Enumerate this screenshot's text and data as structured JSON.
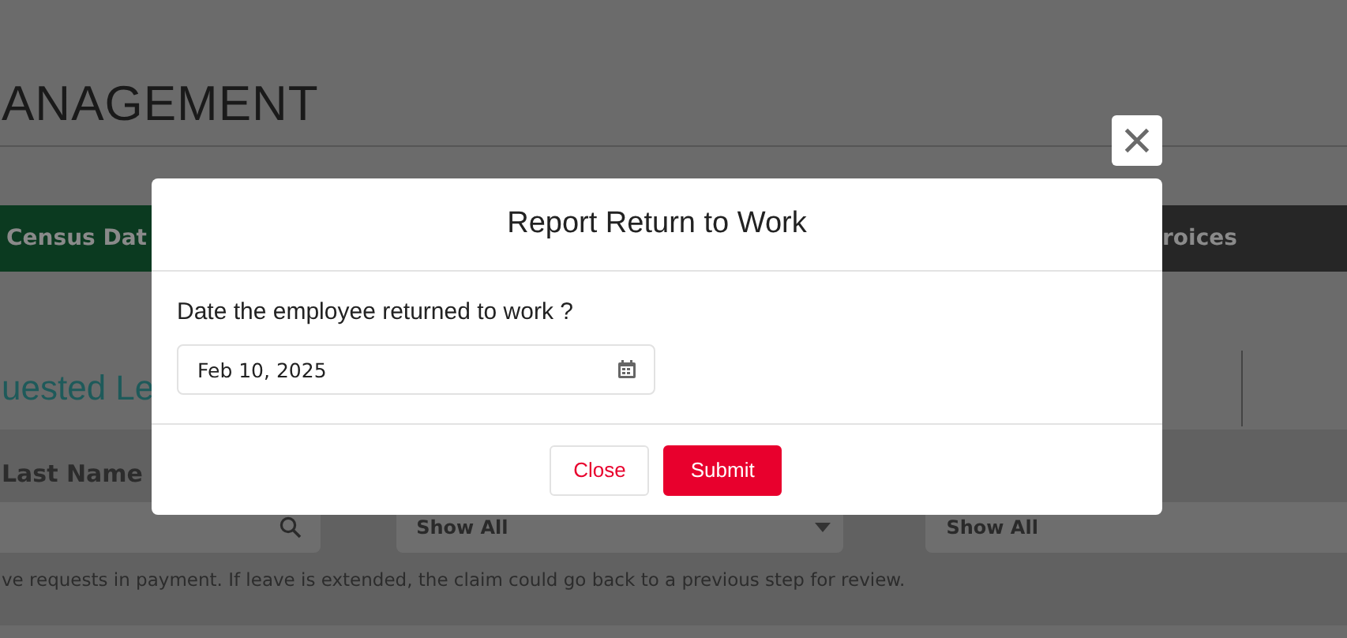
{
  "page": {
    "heading": "ANAGEMENT",
    "nav_tabs": [
      {
        "label": "Census Dat",
        "selected": true
      },
      {
        "label": "roices",
        "selected": false
      }
    ],
    "section_title": "uested Le",
    "filters": [
      {
        "kind": "search",
        "label": "Last Name"
      },
      {
        "kind": "select",
        "value": "Show All"
      },
      {
        "kind": "plain",
        "value": "Show All"
      }
    ],
    "note": "ve requests in payment. If leave is extended, the claim could go back to a previous step for review."
  },
  "modal": {
    "title": "Report Return to Work",
    "question": "Date the employee returned to work ?",
    "date_value": "Feb 10, 2025",
    "buttons": [
      {
        "kind": "secondary",
        "label": "Close"
      },
      {
        "kind": "primary",
        "label": "Submit"
      }
    ]
  }
}
